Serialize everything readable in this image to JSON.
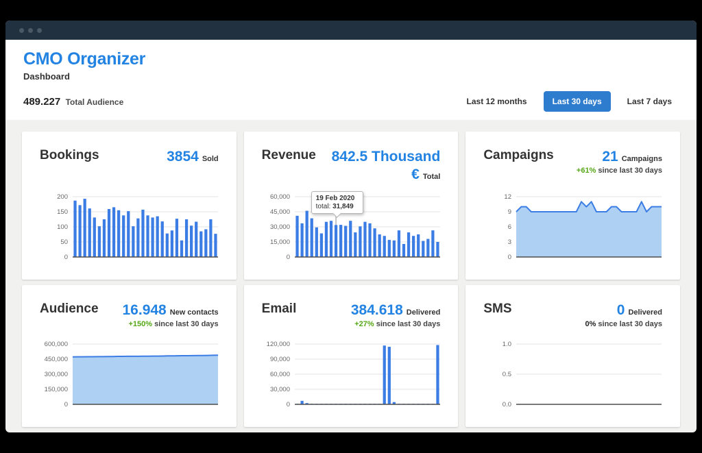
{
  "header": {
    "app_title": "CMO Organizer",
    "subtitle": "Dashboard",
    "total_audience_value": "489.227",
    "total_audience_label": "Total Audience",
    "range_buttons": [
      {
        "label": "Last 12 months",
        "active": false
      },
      {
        "label": "Last 30 days",
        "active": true
      },
      {
        "label": "Last 7 days",
        "active": false
      }
    ]
  },
  "colors": {
    "accent_blue": "#2383e2",
    "bar_blue": "#3b7de4",
    "area_fill": "#aed0f2",
    "area_stroke": "#3b7de4",
    "green": "#55a716",
    "button_active": "#2d7ccd",
    "titlebar": "#22313f",
    "grid_line": "#e3e3e3",
    "axis_line": "#4d4d4d",
    "highlight_line": "#c4c4c4"
  },
  "cards": [
    {
      "id": "bookings",
      "title": "Bookings",
      "value": "3854",
      "unit": "Sold",
      "delta": null,
      "delta_suffix": null,
      "delta_green": false
    },
    {
      "id": "revenue",
      "title": "Revenue",
      "value": "842.5 Thousand €",
      "unit": "Total",
      "delta": null,
      "delta_suffix": null,
      "delta_green": false
    },
    {
      "id": "campaigns",
      "title": "Campaigns",
      "value": "21",
      "unit": "Campaigns",
      "delta": "+61%",
      "delta_suffix": "since last 30 days",
      "delta_green": true
    },
    {
      "id": "audience",
      "title": "Audience",
      "value": "16.948",
      "unit": "New contacts",
      "delta": "+150%",
      "delta_suffix": "since last 30 days",
      "delta_green": true
    },
    {
      "id": "email",
      "title": "Email",
      "value": "384.618",
      "unit": "Delivered",
      "delta": "+27%",
      "delta_suffix": "since last 30 days",
      "delta_green": true
    },
    {
      "id": "sms",
      "title": "SMS",
      "value": "0",
      "unit": "Delivered",
      "delta": "0%",
      "delta_suffix": "since last 30 days",
      "delta_green": false
    }
  ],
  "chart_data": [
    {
      "type": "bar",
      "title": "Bookings daily sold",
      "ymax": 200,
      "ytick_values": [
        0,
        50,
        100,
        150,
        200
      ],
      "ytick_labels": [
        "0",
        "50",
        "100",
        "150",
        "200"
      ],
      "values": [
        187,
        172,
        193,
        161,
        131,
        102,
        125,
        159,
        165,
        155,
        138,
        152,
        102,
        128,
        157,
        138,
        131,
        135,
        118,
        78,
        88,
        127,
        55,
        125,
        104,
        117,
        85,
        92,
        125,
        77
      ]
    },
    {
      "type": "bar",
      "title": "Revenue daily total",
      "ymax": 60000,
      "ytick_values": [
        0,
        15000,
        30000,
        45000,
        60000
      ],
      "ytick_labels": [
        "0",
        "15,000",
        "30,000",
        "45,000",
        "60,000"
      ],
      "values": [
        41000,
        33500,
        46000,
        38500,
        29500,
        23500,
        35000,
        36000,
        31849,
        32000,
        31000,
        36000,
        24500,
        30500,
        35000,
        33500,
        28500,
        22500,
        21000,
        17000,
        16500,
        26500,
        13000,
        24500,
        21000,
        22500,
        16000,
        18000,
        26500,
        15000
      ],
      "selected_index": 8,
      "tooltip": {
        "date": "19 Feb 2020",
        "label": "total:",
        "value": "31,849"
      }
    },
    {
      "type": "area",
      "title": "Campaigns active per day",
      "ymax": 12,
      "ytick_values": [
        0,
        3,
        6,
        9,
        12
      ],
      "ytick_labels": [
        "0",
        "3",
        "6",
        "9",
        "12"
      ],
      "values": [
        9,
        10,
        10,
        9,
        9,
        9,
        9,
        9,
        9,
        9,
        9,
        9,
        9,
        11,
        10,
        11,
        9,
        9,
        9,
        10,
        10,
        9,
        9,
        9,
        9,
        11,
        9,
        10,
        10,
        10
      ]
    },
    {
      "type": "area",
      "title": "Audience total contacts",
      "ymax": 600000,
      "ytick_values": [
        0,
        150000,
        300000,
        450000,
        600000
      ],
      "ytick_labels": [
        "0",
        "150,000",
        "300,000",
        "450,000",
        "600,000"
      ],
      "values": [
        472000,
        473000,
        473000,
        474000,
        474000,
        475000,
        475000,
        476000,
        476000,
        477000,
        477000,
        478000,
        478000,
        478000,
        479000,
        479000,
        480000,
        480000,
        481000,
        482000,
        482000,
        483000,
        484000,
        484000,
        485000,
        486000,
        486000,
        487000,
        488000,
        489000
      ]
    },
    {
      "type": "bar",
      "title": "Email delivered per day",
      "ymax": 120000,
      "ytick_values": [
        0,
        30000,
        60000,
        90000,
        120000
      ],
      "ytick_labels": [
        "0",
        "30,000",
        "60,000",
        "90,000",
        "120,000"
      ],
      "values": [
        600,
        7000,
        2500,
        500,
        400,
        500,
        400,
        500,
        400,
        500,
        600,
        500,
        400,
        700,
        500,
        400,
        800,
        500,
        117000,
        114500,
        4500,
        800,
        600,
        700,
        600,
        500,
        400,
        500,
        600,
        118000
      ]
    },
    {
      "type": "line",
      "title": "SMS delivered per day",
      "ymax": 1,
      "ytick_values": [
        0,
        0.5,
        1
      ],
      "ytick_labels": [
        "0.0",
        "0.5",
        "1.0"
      ],
      "values": []
    }
  ]
}
